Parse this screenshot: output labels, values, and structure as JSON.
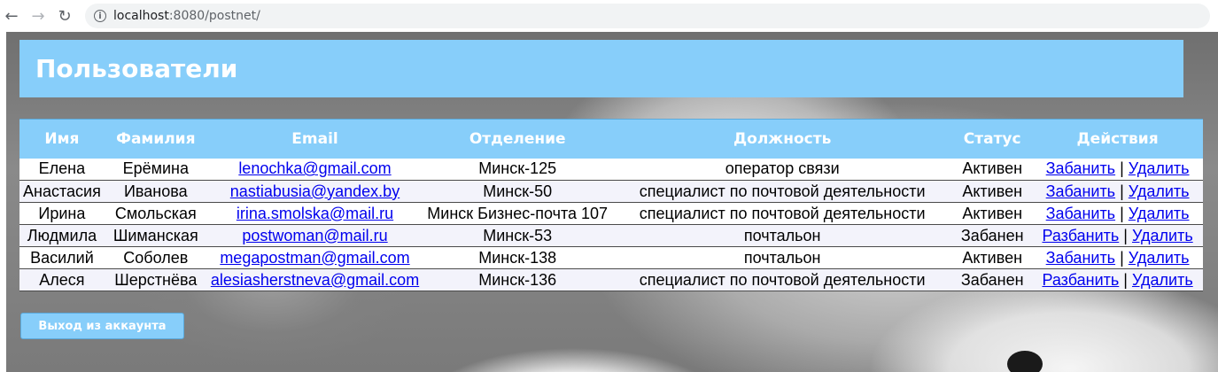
{
  "browser": {
    "url_host": "localhost",
    "url_rest": ":8080/postnet/",
    "back_icon": "←",
    "forward_icon": "→",
    "reload_icon": "↻",
    "info_icon": "i"
  },
  "page": {
    "title": "Пользователи",
    "logout_label": "Выход из аккаунта"
  },
  "colors": {
    "accent": "#87cefa",
    "link": "#0000ee"
  },
  "table": {
    "headers": [
      "Имя",
      "Фамилия",
      "Email",
      "Отделение",
      "Должность",
      "Статус",
      "Действия"
    ],
    "rows": [
      {
        "first": "Елена",
        "last": "Ерёмина",
        "email": "lenochka@gmail.com",
        "dept": "Минск-125",
        "position": "оператор связи",
        "status": "Активен",
        "action1": "Забанить",
        "sep": "|",
        "action2": "Удалить"
      },
      {
        "first": "Анастасия",
        "last": "Иванова",
        "email": "nastiabusia@yandex.by",
        "dept": "Минск-50",
        "position": "специалист по почтовой деятельности",
        "status": "Активен",
        "action1": "Забанить",
        "sep": "|",
        "action2": "Удалить"
      },
      {
        "first": "Ирина",
        "last": "Смольская",
        "email": "irina.smolska@mail.ru",
        "dept": "Минск Бизнес-почта 107",
        "position": "специалист по почтовой деятельности",
        "status": "Активен",
        "action1": "Забанить",
        "sep": "|",
        "action2": "Удалить"
      },
      {
        "first": "Людмила",
        "last": "Шиманская",
        "email": "postwoman@mail.ru",
        "dept": "Минск-53",
        "position": "почтальон",
        "status": "Забанен",
        "action1": "Разбанить",
        "sep": "|",
        "action2": "Удалить"
      },
      {
        "first": "Василий",
        "last": "Соболев",
        "email": "megapostman@gmail.com",
        "dept": "Минск-138",
        "position": "почтальон",
        "status": "Активен",
        "action1": "Забанить",
        "sep": "|",
        "action2": "Удалить"
      },
      {
        "first": "Алеся",
        "last": "Шерстнёва",
        "email": "alesiasherstneva@gmail.com",
        "dept": "Минск-136",
        "position": "специалист по почтовой деятельности",
        "status": "Забанен",
        "action1": "Разбанить",
        "sep": "|",
        "action2": "Удалить"
      }
    ]
  }
}
